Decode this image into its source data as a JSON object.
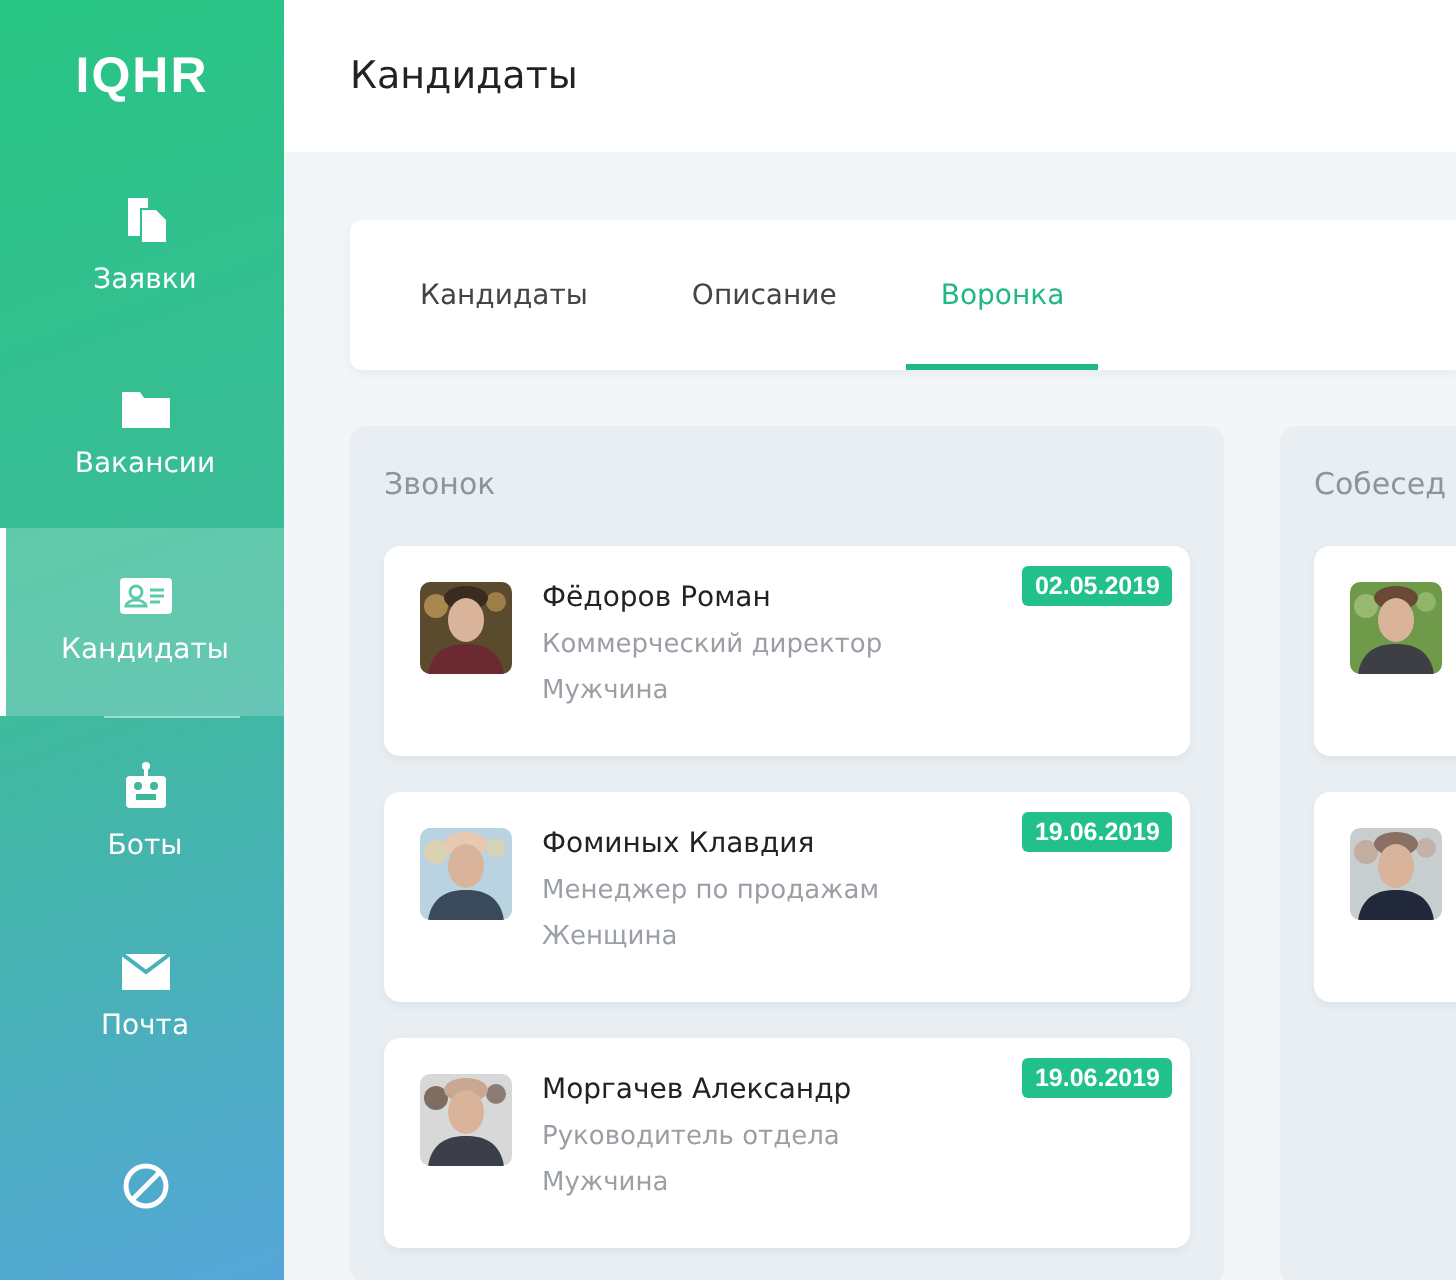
{
  "sidebar": {
    "logo": "IQHR",
    "items": [
      {
        "label": "Заявки",
        "selected": false
      },
      {
        "label": "Вакансии",
        "selected": false
      },
      {
        "label": "Кандидаты",
        "selected": true
      },
      {
        "label": "Боты",
        "selected": false
      },
      {
        "label": "Почта",
        "selected": false
      },
      {
        "selected": false
      }
    ]
  },
  "header": {
    "title": "Кандидаты"
  },
  "tabs": [
    {
      "label": "Кандидаты",
      "selected": false
    },
    {
      "label": "Описание",
      "selected": false
    },
    {
      "label": "Воронка",
      "selected": true
    }
  ],
  "columns": [
    {
      "title": "Звонок",
      "cards": [
        {
          "kind": "picture",
          "name": "Фёдоров Роман",
          "position": "Коммерческий директор",
          "gender": "Мужчина",
          "date": "02.05.2019"
        },
        {
          "kind": "picture",
          "name": "Фоминых Клавдия",
          "position": "Менеджер по продажам",
          "gender": "Женщина",
          "date": "19.06.2019"
        },
        {
          "kind": "picture",
          "name": "Моргачев Александр",
          "position": "Руководитель отдела",
          "gender": "Мужчина",
          "date": "19.06.2019"
        }
      ]
    },
    {
      "title": "Собесед"
    }
  ]
}
